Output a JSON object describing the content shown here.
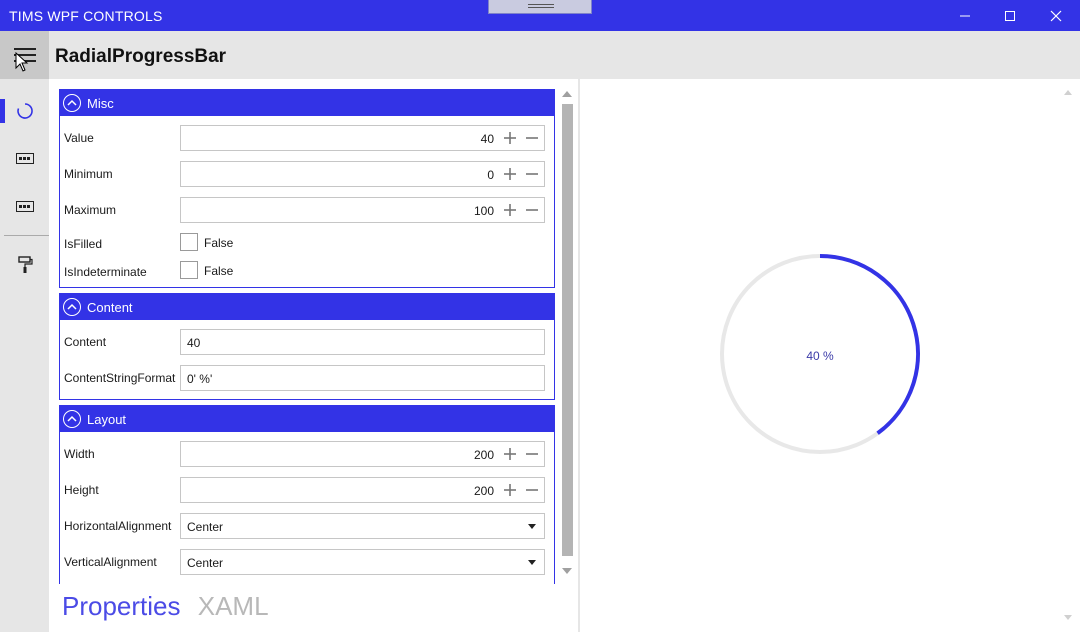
{
  "window": {
    "title": "TIMS WPF CONTROLS",
    "controls": [
      "minimize",
      "maximize",
      "close"
    ]
  },
  "header": {
    "page_title": "RadialProgressBar"
  },
  "nav": {
    "items": [
      {
        "icon": "circle-progress-icon",
        "active": true
      },
      {
        "icon": "textbox-icon",
        "active": false
      },
      {
        "icon": "textbox-icon",
        "active": false
      },
      {
        "icon": "paint-roller-icon",
        "active": false
      }
    ]
  },
  "sections": {
    "misc": {
      "title": "Misc",
      "value_label": "Value",
      "value": "40",
      "minimum_label": "Minimum",
      "minimum": "0",
      "maximum_label": "Maximum",
      "maximum": "100",
      "isfilled_label": "IsFilled",
      "isfilled": "False",
      "isindeterminate_label": "IsIndeterminate",
      "isindeterminate": "False"
    },
    "content": {
      "title": "Content",
      "content_label": "Content",
      "content": "40",
      "format_label": "ContentStringFormat",
      "format": "0' %'"
    },
    "layout": {
      "title": "Layout",
      "width_label": "Width",
      "width": "200",
      "height_label": "Height",
      "height": "200",
      "halign_label": "HorizontalAlignment",
      "halign": "Center",
      "valign_label": "VerticalAlignment",
      "valign": "Center"
    }
  },
  "tabs": {
    "properties": "Properties",
    "xaml": "XAML"
  },
  "preview": {
    "progress_text": "40 %",
    "progress_fraction": 0.4,
    "track_color": "#e8e8e8",
    "fill_color": "#3333e6"
  },
  "colors": {
    "accent": "#3333e6"
  }
}
